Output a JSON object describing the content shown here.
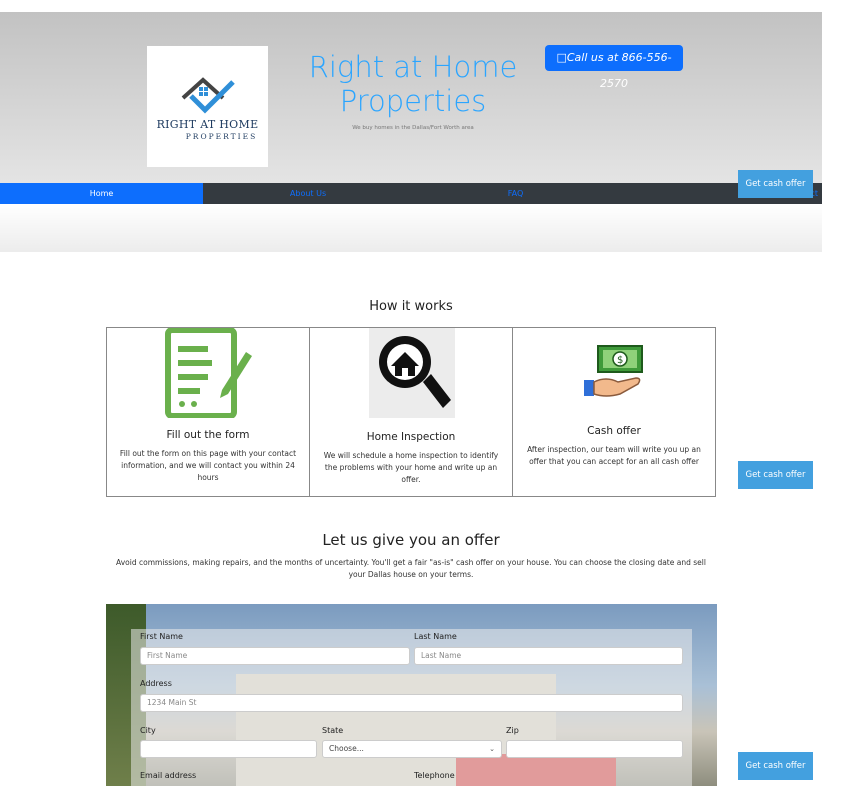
{
  "header": {
    "logo": {
      "line1": "RIGHT AT HOME",
      "line2": "PROPERTIES"
    },
    "title_line1": "Right at Home",
    "title_line2": "Properties",
    "tagline": "We buy homes in the Dallas/Fort Worth area",
    "call_button": "Call us at 866-556-2570"
  },
  "nav": {
    "items": [
      "Home",
      "About Us",
      "FAQ",
      "Contact"
    ],
    "active": "Home"
  },
  "side_button": "Get cash offer",
  "how_it_works": {
    "heading": "How it works",
    "cards": [
      {
        "title": "Fill out the form",
        "text": "Fill out the form on this page with your contact information, and we will contact you within 24 hours",
        "icon": "document-pen-icon"
      },
      {
        "title": "Home Inspection",
        "text": "We will schedule a home inspection to identify the problems with your home and write up an offer.",
        "icon": "magnifier-house-icon"
      },
      {
        "title": "Cash offer",
        "text": "After inspection, our team will write you up an offer that you can accept for an all cash offer",
        "icon": "hand-cash-icon"
      }
    ]
  },
  "offer": {
    "heading": "Let us give you an offer",
    "text": "Avoid commissions, making repairs, and the months of uncertainty. You'll get a fair \"as-is\" cash offer on your house. You can choose the closing date and sell your Dallas house on your terms."
  },
  "form": {
    "first_name_label": "First Name",
    "first_name_placeholder": "First Name",
    "last_name_label": "Last Name",
    "last_name_placeholder": "Last Name",
    "address_label": "Address",
    "address_placeholder": "1234 Main St",
    "city_label": "City",
    "state_label": "State",
    "state_selected": "Choose...",
    "zip_label": "Zip",
    "email_label": "Email address",
    "telephone_label": "Telephone"
  },
  "colors": {
    "primary": "#0d6efd",
    "nav_bg": "#343a40",
    "accent": "#43a0df",
    "title_blue": "#2ba5ff",
    "icon_green": "#6ab04c"
  }
}
